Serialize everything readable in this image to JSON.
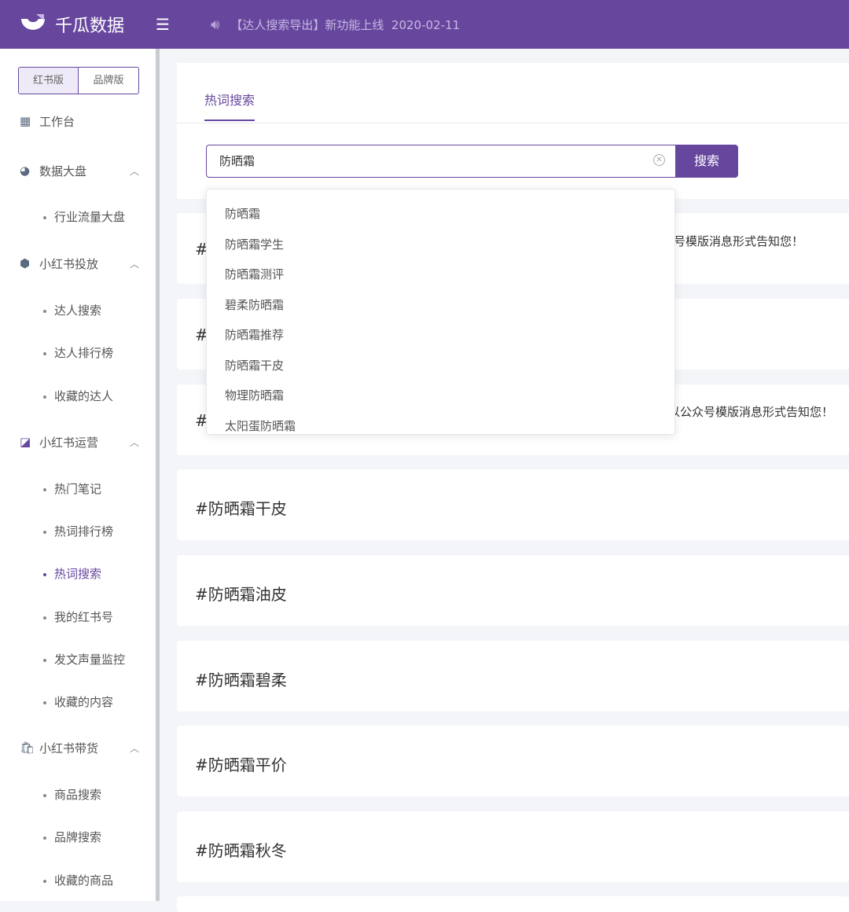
{
  "header": {
    "brand": "千瓜数据",
    "notice": "【达人搜索导出】新功能上线",
    "date": "2020-02-11"
  },
  "sidebar": {
    "versions": [
      "红书版",
      "品牌版"
    ],
    "sections": [
      {
        "label": "工作台",
        "icon": "grid-icon",
        "items": []
      },
      {
        "label": "数据大盘",
        "icon": "pie-chart-icon",
        "items": [
          "行业流量大盘"
        ]
      },
      {
        "label": "小红书投放",
        "icon": "cube-icon",
        "items": [
          "达人搜索",
          "达人排行榜",
          "收藏的达人"
        ]
      },
      {
        "label": "小红书运营",
        "icon": "chart-icon",
        "items": [
          "热门笔记",
          "热词排行榜",
          "热词搜索",
          "我的红书号",
          "发文声量监控",
          "收藏的内容"
        ]
      },
      {
        "label": "小红书带货",
        "icon": "bag-icon",
        "items": [
          "商品搜索",
          "品牌搜索",
          "收藏的商品"
        ]
      }
    ]
  },
  "main": {
    "tab": "热词搜索",
    "search_value": "防晒霜",
    "search_button": "搜索",
    "suggestions": [
      "防晒霜",
      "防晒霜学生",
      "防晒霜测评",
      "碧柔防晒霜",
      "防晒霜推荐",
      "防晒霜干皮",
      "物理防晒霜",
      "太阳蛋防晒霜"
    ],
    "hidden_cards": [
      {
        "hash": "#",
        "text": "号模版消息形式告知您！"
      },
      {
        "hash": "#",
        "text": ""
      },
      {
        "hash": "#",
        "text": "以公众号模版消息形式告知您！"
      }
    ],
    "results": [
      "#防晒霜干皮",
      "#防晒霜油皮",
      "#防晒霜碧柔",
      "#防晒霜平价",
      "#防晒霜秋冬"
    ]
  }
}
